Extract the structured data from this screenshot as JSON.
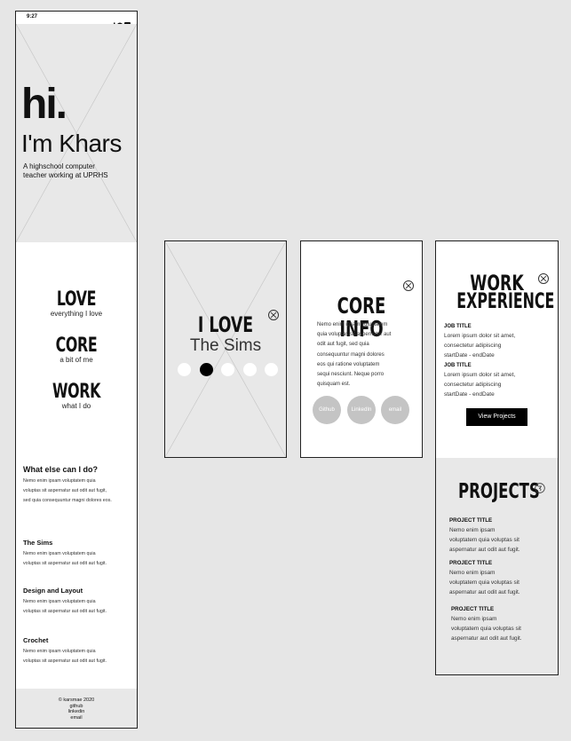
{
  "status_bar": {
    "time": "9:27",
    "icons": "signal-wifi-battery"
  },
  "hero": {
    "hi": "hi.",
    "name": "I'm Khars",
    "subtitle_line1": "A highschool computer",
    "subtitle_line2": "teacher working at UPRHS"
  },
  "menu": [
    {
      "title": "LOVE",
      "sub": "everything I love"
    },
    {
      "title": "CORE",
      "sub": "a bit of me"
    },
    {
      "title": "WORK",
      "sub": "what I do"
    }
  ],
  "what_else": {
    "heading": "What else can I do?",
    "text_lines": [
      "Nemo enim ipsam voluptatem quia",
      "voluptas sit aspernatur aut odit aut fugit,",
      "sed quia consequuntur magni dolores eos."
    ]
  },
  "items": [
    {
      "title": "The Sims",
      "lines": [
        "Nemo enim ipsam voluptatem quia",
        "voluptas sit aspernatur aut odit aut fugit."
      ]
    },
    {
      "title": "Design and Layout",
      "lines": [
        "Nemo enim ipsam voluptatem quia",
        "voluptas sit aspernatur aut odit aut fugit."
      ]
    },
    {
      "title": "Crochet",
      "lines": [
        "Nemo enim ipsam voluptatem quia",
        "voluptas sit aspernatur aut odit aut fugit."
      ]
    }
  ],
  "footer": {
    "copyright": "©  karsmae 2020",
    "links": [
      "github",
      "linkedin",
      "email"
    ]
  },
  "love_card": {
    "heading": "I LOVE",
    "subject": "The Sims",
    "dots_total": 5,
    "active_dot": 2
  },
  "core_card": {
    "heading": "CORE INFO",
    "lines": [
      "Nemo enim ipsam voluptatem",
      "quia voluptas sit aspernatur aut",
      "odit aut fugit, sed quia",
      "consequuntur magni dolores",
      "eos qui ratione voluptatem",
      "sequi nesciunt. Neque porro",
      "quisquam est."
    ],
    "links": [
      "Github",
      "LinkedIn",
      "email"
    ]
  },
  "work_card": {
    "heading_line1": "WORK",
    "heading_line2": "EXPERIENCE",
    "jobs": [
      {
        "title": "JOB TITLE",
        "lines": [
          "Lorem ipsum dolor sit amet,",
          "consectetur adipiscing",
          "startDate - endDate"
        ]
      },
      {
        "title": "JOB TITLE",
        "lines": [
          "Lorem ipsum dolor sit amet,",
          "consectetur adipiscing",
          "startDate - endDate"
        ]
      }
    ],
    "button": "View Projects"
  },
  "projects_card": {
    "heading": "PROJECTS",
    "projects": [
      {
        "title": "PROJECT TITLE",
        "lines": [
          "Nemo enim ipsam",
          "voluptatem quia voluptas sit",
          "aspernatur aut odit aut fugit."
        ]
      },
      {
        "title": "PROJECT TITLE",
        "lines": [
          "Nemo enim ipsam",
          "voluptatem quia voluptas sit",
          "aspernatur aut odit aut fugit."
        ]
      },
      {
        "title": "PROJECT TITLE",
        "lines": [
          "Nemo enim ipsam",
          "voluptatem quia voluptas sit",
          "aspernatur aut odit aut fugit."
        ]
      }
    ]
  }
}
